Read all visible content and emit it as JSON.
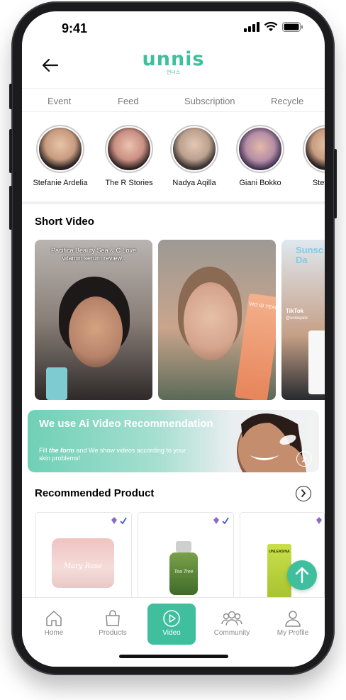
{
  "status_bar": {
    "time": "9:41"
  },
  "header": {
    "logo": "unnis",
    "logo_sub": "언니스"
  },
  "tabs": [
    "Event",
    "Feed",
    "Subscription",
    "Recycle"
  ],
  "stories": [
    {
      "name": "Stefanie Ardelia"
    },
    {
      "name": "The R Stories"
    },
    {
      "name": "Nadya Aqilla"
    },
    {
      "name": "Giani Bokko"
    },
    {
      "name": "Stefanie"
    }
  ],
  "short_video": {
    "title": "Short Video",
    "videos": [
      {
        "caption": "Pacifica Beauty  Sea & C Love vitamin serum review..",
        "product_text": ""
      },
      {
        "caption": "",
        "product_text": "WO ID YEAR"
      },
      {
        "caption": "",
        "brand_text": "Sunsc Da",
        "tiktok": "TikTok",
        "handle": "@unnispick"
      }
    ]
  },
  "banner": {
    "title": "We use Ai Video Recommendation",
    "desc_prefix": "Fill ",
    "desc_emph": "the form",
    "desc_suffix": " and We show videos according to your skin problems!"
  },
  "recommended": {
    "title": "Recommended Product"
  },
  "products": [
    {
      "jar_text": "Mary Rose"
    },
    {
      "bottle_text": "Tea Tree"
    },
    {
      "tube_text": "UNLEASHIA"
    }
  ],
  "bottom_nav": {
    "items": [
      {
        "label": "Home",
        "icon": "home-icon"
      },
      {
        "label": "Products",
        "icon": "bag-icon"
      },
      {
        "label": "Video",
        "icon": "play-icon",
        "active": true
      },
      {
        "label": "Community",
        "icon": "people-icon"
      },
      {
        "label": "My Profile",
        "icon": "person-icon"
      }
    ]
  },
  "colors": {
    "accent": "#3fbf9e"
  }
}
